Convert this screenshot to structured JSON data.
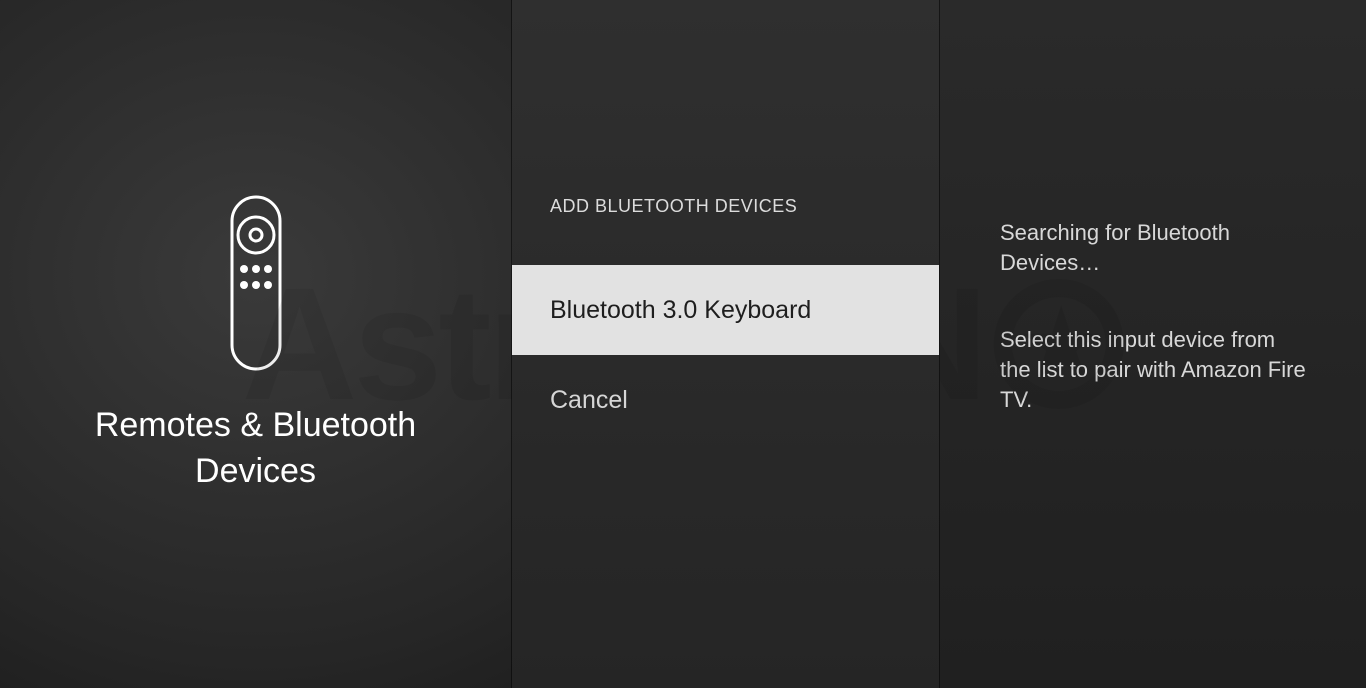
{
  "left": {
    "title": "Remotes & Bluetooth Devices"
  },
  "mid": {
    "header": "ADD BLUETOOTH DEVICES",
    "device_label": "Bluetooth 3.0 Keyboard",
    "cancel_label": "Cancel"
  },
  "right": {
    "searching": "Searching for Bluetooth Devices…",
    "instruction": "Select this input device from the list to pair with Amazon Fire TV."
  },
  "watermark": {
    "text": "AstrillVPN"
  }
}
